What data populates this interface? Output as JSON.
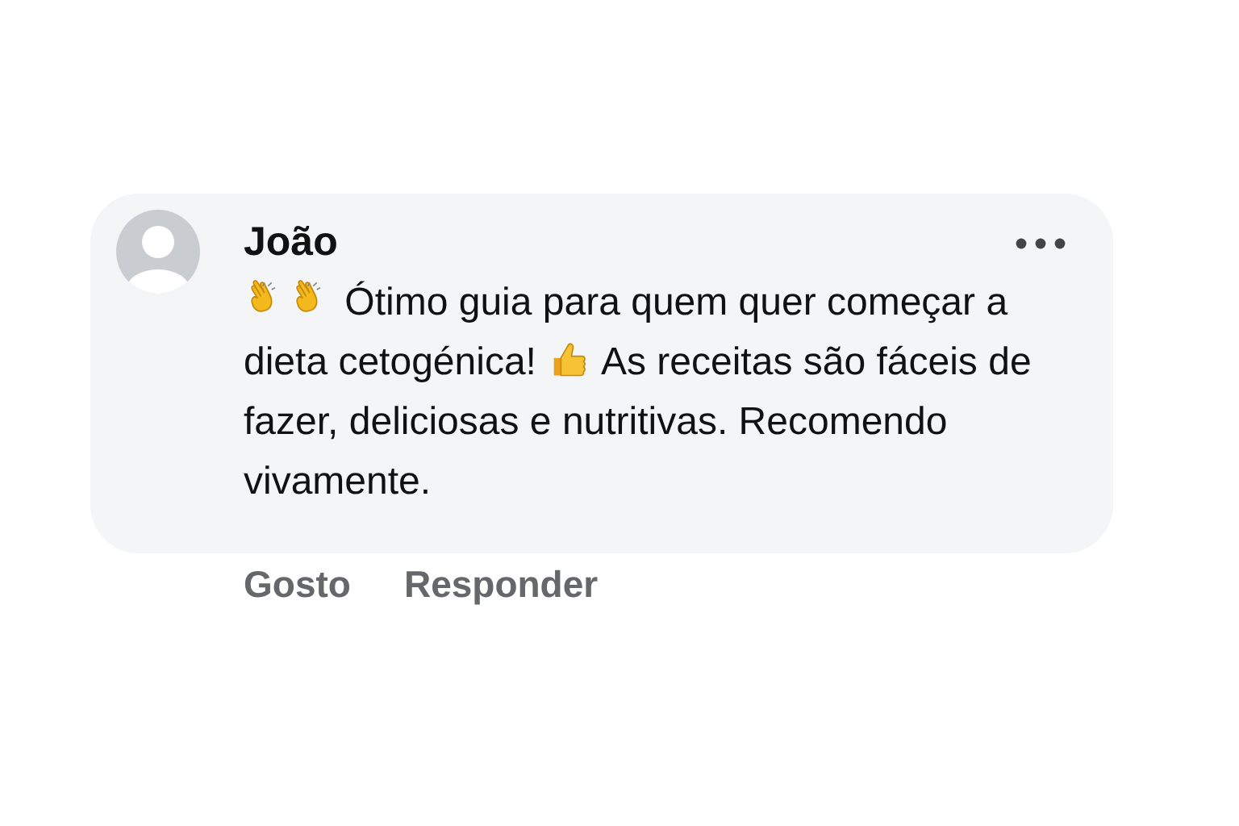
{
  "comment": {
    "author": "João",
    "body": [
      {
        "kind": "clap"
      },
      {
        "kind": "clap"
      },
      {
        "kind": "text",
        "text": " Ótimo guia para quem quer começar a dieta cetogénica! "
      },
      {
        "kind": "thumbs-up"
      },
      {
        "kind": "text",
        "text": " As receitas são fáceis de fazer, deliciosas e nutritivas. Recomendo vivamente."
      }
    ],
    "actions": [
      "Gosto",
      "Responder"
    ]
  }
}
